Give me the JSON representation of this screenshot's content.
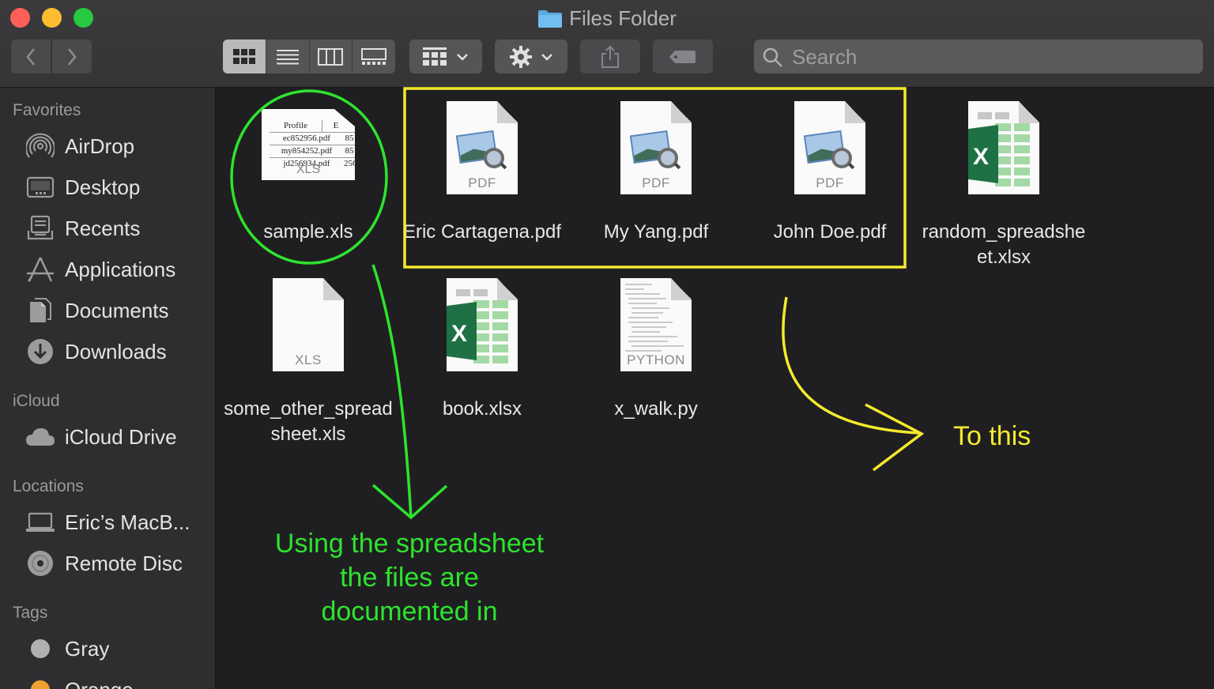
{
  "window": {
    "title": "Files Folder"
  },
  "toolbar": {
    "back_icon": "chevron-left-icon",
    "forward_icon": "chevron-right-icon",
    "view_modes": [
      "icon-view-icon",
      "list-view-icon",
      "column-view-icon",
      "gallery-view-icon"
    ],
    "active_view": "icon-view-icon",
    "group_icon": "group-by-icon",
    "action_icon": "gear-icon",
    "share_icon": "share-icon",
    "tag_icon": "tag-icon",
    "search_placeholder": "Search"
  },
  "sidebar": {
    "favorites_label": "Favorites",
    "favorites": [
      {
        "label": "AirDrop",
        "icon": "airdrop-icon"
      },
      {
        "label": "Desktop",
        "icon": "desktop-icon"
      },
      {
        "label": "Recents",
        "icon": "recents-icon"
      },
      {
        "label": "Applications",
        "icon": "applications-icon"
      },
      {
        "label": "Documents",
        "icon": "documents-icon"
      },
      {
        "label": "Downloads",
        "icon": "downloads-icon"
      }
    ],
    "icloud_label": "iCloud",
    "icloud": [
      {
        "label": "iCloud Drive",
        "icon": "cloud-icon"
      }
    ],
    "locations_label": "Locations",
    "locations": [
      {
        "label": "Eric’s MacB...",
        "icon": "laptop-icon"
      },
      {
        "label": "Remote Disc",
        "icon": "disc-icon"
      }
    ],
    "tags_label": "Tags",
    "tags": [
      {
        "label": "Gray",
        "color": "#b0b0b2"
      },
      {
        "label": "Orange",
        "color": "#f0a030"
      }
    ]
  },
  "files": [
    {
      "name": "sample.xls",
      "kind": "xls-preview",
      "preview_label": "XLS",
      "preview_rows": [
        [
          "Profile",
          "E"
        ],
        [
          "ec852956.pdf",
          "85"
        ],
        [
          "my854252.pdf",
          "85"
        ],
        [
          "jd256934.pdf",
          "256"
        ]
      ]
    },
    {
      "name": "Eric Cartagena.pdf",
      "kind": "pdf",
      "label": "PDF"
    },
    {
      "name": "My Yang.pdf",
      "kind": "pdf",
      "label": "PDF"
    },
    {
      "name": "John Doe.pdf",
      "kind": "pdf",
      "label": "PDF"
    },
    {
      "name": "random_spreadsheet.xlsx",
      "kind": "excel"
    },
    {
      "name": "some_other_spreadsheet.xls",
      "kind": "blank",
      "label": "XLS"
    },
    {
      "name": "book.xlsx",
      "kind": "excel"
    },
    {
      "name": "x_walk.py",
      "kind": "python",
      "label": "PYTHON"
    }
  ],
  "annotations": {
    "green_text": [
      "Using the spreadsheet",
      "the files are",
      "documented in"
    ],
    "yellow_text": "To this",
    "green_color": "#2ee32e",
    "yellow_color": "#f5ea2d"
  }
}
